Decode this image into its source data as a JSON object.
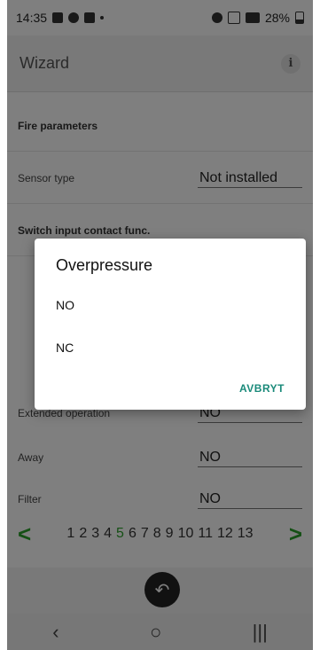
{
  "statusbar": {
    "time": "14:35",
    "battery": "28%"
  },
  "app": {
    "title": "Wizard",
    "info_icon": "i"
  },
  "rows": [
    {
      "kind": "section",
      "label": "Fire parameters"
    },
    {
      "kind": "field",
      "label": "Sensor type",
      "value": "Not installed"
    },
    {
      "kind": "section",
      "label": "Switch input contact func."
    },
    {
      "kind": "field",
      "label": "Extended operation",
      "value": "NO"
    },
    {
      "kind": "field",
      "label": "Away",
      "value": "NO"
    },
    {
      "kind": "field",
      "label": "Filter",
      "value": "NO"
    }
  ],
  "pager": {
    "prev": "<",
    "next": ">",
    "pages": [
      "1",
      "2",
      "3",
      "4",
      "5",
      "6",
      "7",
      "8",
      "9",
      "10",
      "11",
      "12",
      "13"
    ],
    "active_page": "5",
    "active_color": "#2aa12a"
  },
  "bottom": {
    "back_icon": "↶"
  },
  "navbar": {
    "back": "‹",
    "home": "○",
    "recents": "|||"
  },
  "dialog": {
    "title": "Overpressure",
    "options": [
      "NO",
      "NC"
    ],
    "cancel": "AVBRYT",
    "accent": "#1a8a7a"
  }
}
